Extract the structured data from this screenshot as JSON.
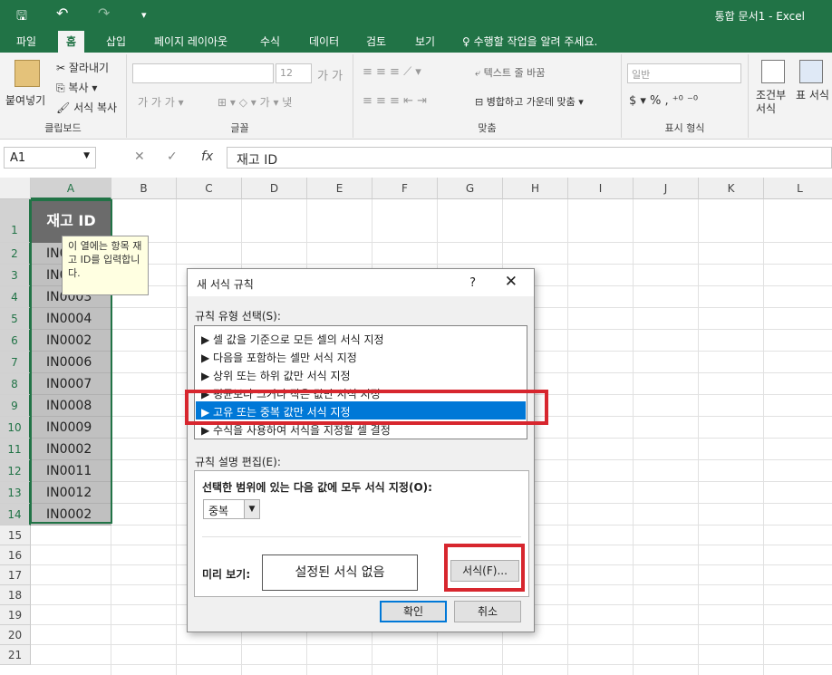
{
  "window": {
    "title": "통합 문서1 - Excel"
  },
  "qat": {
    "save": "🖫",
    "undo": "↶",
    "redo": "↷",
    "customize": "▾"
  },
  "tabs": {
    "file": "파일",
    "home": "홈",
    "insert": "삽입",
    "layout": "페이지 레이아웃",
    "formulas": "수식",
    "data": "데이터",
    "review": "검토",
    "view": "보기",
    "tellme": "♀ 수행할 작업을 알려 주세요."
  },
  "ribbon": {
    "clipboard": {
      "label": "클립보드",
      "paste": "붙여넣기",
      "cut": "잘라내기",
      "copy": "복사",
      "format_painter": "서식 복사"
    },
    "font": {
      "label": "글꼴",
      "size": "12"
    },
    "align": {
      "label": "맞춤",
      "wrap": "텍스트 줄 바꿈",
      "merge": "병합하고 가운데 맞춤"
    },
    "number": {
      "label": "표시 형식",
      "format": "일반"
    },
    "styles": {
      "conditional": "조건부 서식",
      "table": "표 서식"
    }
  },
  "formula_bar": {
    "name_box": "A1",
    "fx": "fx",
    "content": "재고 ID"
  },
  "sheet": {
    "columns": [
      "A",
      "B",
      "C",
      "D",
      "E",
      "F",
      "G",
      "H",
      "I",
      "J",
      "K",
      "L"
    ],
    "rows": [
      "1",
      "2",
      "3",
      "4",
      "5",
      "6",
      "7",
      "8",
      "9",
      "10",
      "11",
      "12",
      "13",
      "14",
      "15",
      "16",
      "17",
      "18",
      "19",
      "20",
      "21"
    ],
    "header_cell": "재고 ID",
    "cells": [
      "IN0001",
      "IN0003",
      "IN0003",
      "IN0004",
      "IN0002",
      "IN0006",
      "IN0007",
      "IN0008",
      "IN0009",
      "IN0002",
      "IN0011",
      "IN0012",
      "IN0002"
    ],
    "tooltip": "이 열에는 항목 재고 ID를 입력합니다."
  },
  "dialog": {
    "title": "새 서식 규칙",
    "help": "?",
    "close": "✕",
    "rule_type_label": "규칙 유형 선택(S):",
    "rule_types": [
      "▶ 셀 값을 기준으로 모든 셀의 서식 지정",
      "▶ 다음을 포함하는 셀만 서식 지정",
      "▶ 상위 또는 하위 값만 서식 지정",
      "▶ 평균보다 크거나 작은 값만 서식 지정",
      "▶ 고유 또는 중복 값만 서식 지정",
      "▶ 수식을 사용하여 서식을 지정할 셀 결정"
    ],
    "selected_rule_index": 4,
    "desc_label": "규칙 설명 편집(E):",
    "desc_heading": "선택한 범위에 있는 다음 값에 모두 서식 지정(O):",
    "dropdown_value": "중복",
    "preview_label": "미리 보기:",
    "preview_text": "설정된 서식 없음",
    "format_button": "서식(F)...",
    "ok": "확인",
    "cancel": "취소"
  },
  "colors": {
    "excel_green": "#217346",
    "highlight": "#d7262e",
    "selection_blue": "#0078d7"
  }
}
